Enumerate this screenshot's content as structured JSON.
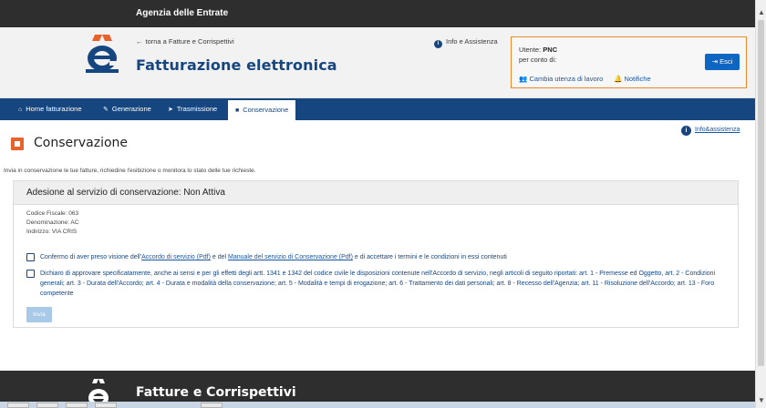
{
  "topbar": {
    "agency": "Agenzia delle Entrate"
  },
  "header": {
    "back_link": "torna a Fatture e Corrispettivi",
    "app_title": "Fatturazione elettronica",
    "info_link": "Info e Assistenza"
  },
  "user": {
    "label": "Utente:",
    "name": "PNC",
    "conto": "per conto di:",
    "cambia": "Cambia utenza di lavoro",
    "notifiche": "Notifiche",
    "esci": "Esci"
  },
  "nav": {
    "items": [
      {
        "label": "Home fatturazione",
        "icon": "home-icon"
      },
      {
        "label": "Generazione",
        "icon": "pencil-icon"
      },
      {
        "label": "Trasmissione",
        "icon": "send-icon"
      },
      {
        "label": "Conservazione",
        "icon": "archive-icon"
      }
    ]
  },
  "page": {
    "title": "Conservazione",
    "help": "Info&assistenza",
    "intro": "Invia in conservazione le tue fatture, richiedine l'esibizione o monitora lo stato delle tue richieste."
  },
  "card": {
    "title": "Adesione al servizio di conservazione: Non Attiva",
    "codice_fiscale": "Codice Fiscale: 063",
    "denominazione": "Denominazione: AC",
    "indirizzo": "Indirizzo: VIA CRIS",
    "check1": {
      "pre": "Confermo di aver preso visione dell'",
      "link1": "Accordo di servizio (Pdf)",
      "mid": " e del ",
      "link2": "Manuale del servizio di Conservazione (Pdf)",
      "post": " e di accettare i termini e le condizioni in essi contenuti"
    },
    "check2": "Dichiaro di approvare specificatamente, anche ai sensi e per gli effetti degli artt. 1341 e 1342 del codice civile le disposizioni contenute nell'Accordo di servizio, negli articoli di seguito riportati: art. 1 - Premesse ed Oggetto, art. 2 - Condizioni generali; art. 3 - Durata dell'Accordo; art. 4 - Durata e modalità della conservazione; art. 5 - Modalità e tempi di erogazione; art. 6 - Trattamento dei dati personali; art. 8 - Recesso dell'Agenzia; art. 11 - Risoluzione dell'Accordo; art. 13 - Foro competente",
    "invia": "Invia"
  },
  "footer": {
    "title": "Fatture e Corrispettivi"
  },
  "colors": {
    "primary": "#16467f",
    "accent": "#e8632b",
    "button": "#0d66c2",
    "topbar": "#2e2e2e"
  }
}
